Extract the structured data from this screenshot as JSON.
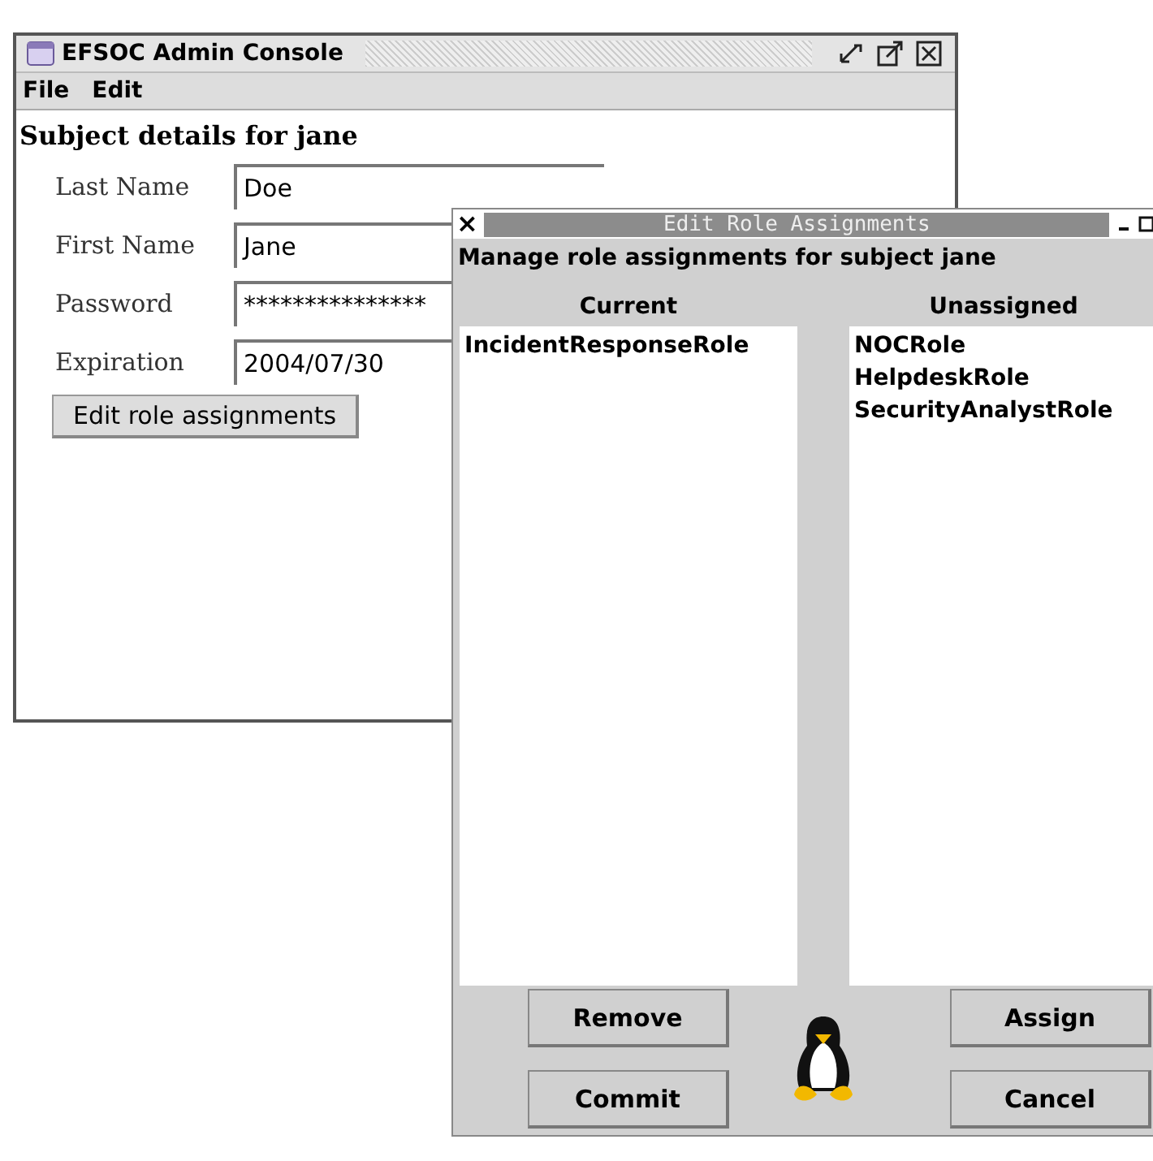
{
  "main_window": {
    "title": "EFSOC Admin Console",
    "menu": [
      "File",
      "Edit"
    ],
    "heading": "Subject details for jane",
    "fields": [
      {
        "label": "Last Name",
        "value": "Doe"
      },
      {
        "label": "First Name",
        "value": "Jane"
      },
      {
        "label": "Password",
        "value": "***************"
      },
      {
        "label": "Expiration",
        "value": "2004/07/30"
      }
    ],
    "button": "Edit role assignments"
  },
  "dialog": {
    "close_glyph": "×",
    "title": "Edit Role Assignments",
    "message": "Manage role assignments for subject jane",
    "lists": [
      {
        "heading": "Current",
        "items": [
          "IncidentResponseRole"
        ]
      },
      {
        "heading": "Unassigned",
        "items": [
          "NOCRole",
          "HelpdeskRole",
          "SecurityAnalystRole"
        ]
      }
    ],
    "buttons": [
      [
        "Remove",
        "Assign"
      ],
      [
        "Commit",
        "Cancel"
      ]
    ]
  }
}
